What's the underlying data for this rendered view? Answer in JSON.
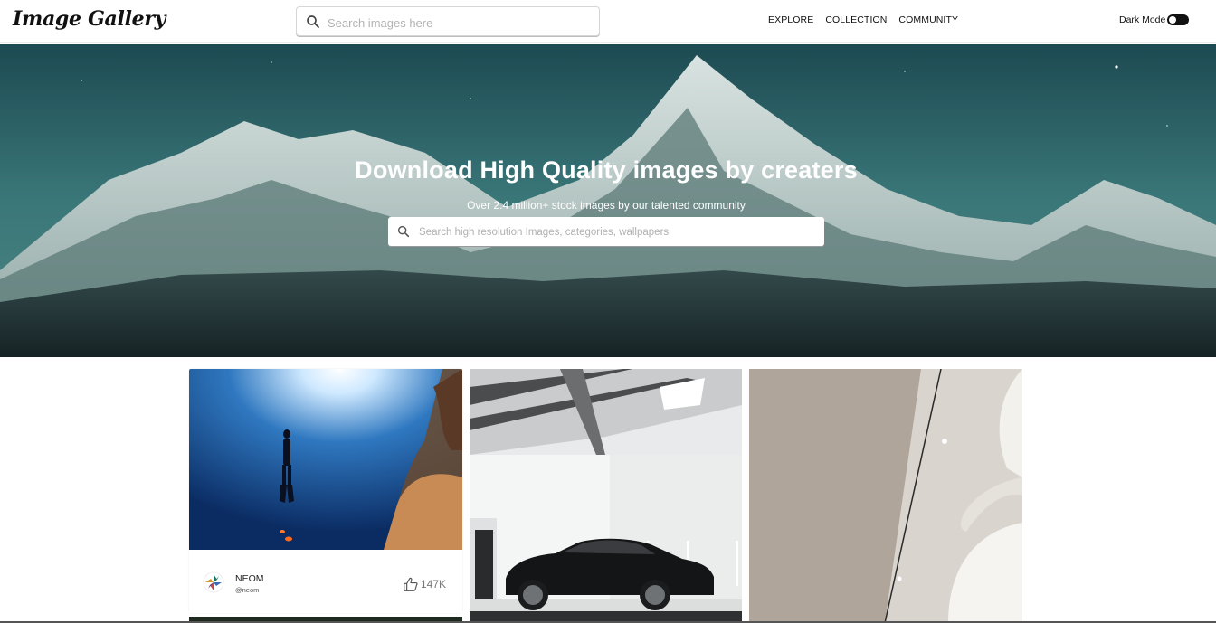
{
  "app": {
    "logo": "Image Gallery"
  },
  "nav": {
    "search_placeholder": "Search images here",
    "links": [
      "EXPLORE",
      "COLLECTION",
      "COMMUNITY"
    ],
    "dark_mode_label": "Dark Mode",
    "dark_mode_on": true
  },
  "hero": {
    "title": "Download High Quality images by creaters",
    "subtitle": "Over 2.4 million+ stock images by our talented community",
    "search_placeholder": "Search high resolution Images, categories, wallpapers"
  },
  "gallery": {
    "cards": [
      {
        "image": "underwater-freediver",
        "author_name": "NEOM",
        "author_handle": "@neom",
        "likes": "147K"
      },
      {
        "image": "black-car-in-white-garage"
      },
      {
        "image": "beige-curved-wall-architecture"
      },
      {
        "image": "dark-foliage"
      }
    ]
  },
  "icons": {
    "search": "search-icon",
    "like": "thumbs-up-icon",
    "toggle": "toggle-switch"
  },
  "colors": {
    "accent": "#111111",
    "hero_sky": "#2e6a6f"
  }
}
